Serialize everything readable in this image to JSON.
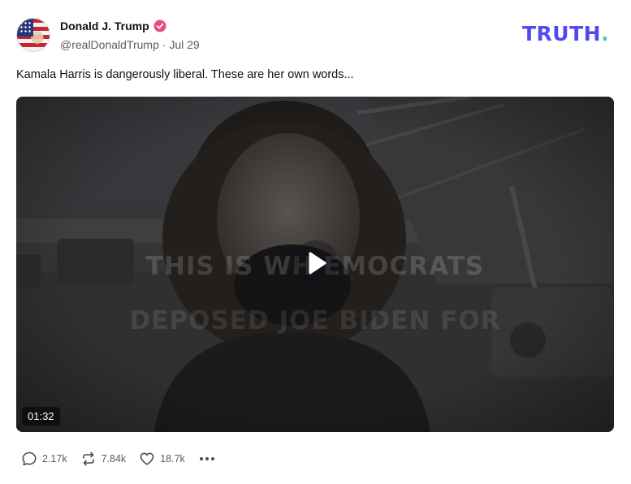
{
  "post": {
    "author_name": "Donald J. Trump",
    "handle": "@realDonaldTrump",
    "separator": " · ",
    "date": "Jul 29",
    "text": "Kamala Harris is dangerously liberal. These are her own words...",
    "verified_icon": "verified-badge-icon",
    "verified_color": "#ea4c7d"
  },
  "brand": {
    "logo_text": "TRUTH",
    "logo_dot": ".",
    "logo_color": "#5448ee",
    "dot_color": "#2fd7b4"
  },
  "video": {
    "caption_line_1": "THIS IS WH   EMOCRATS",
    "caption_line_2": "DEPOSED JOE BIDEN FOR",
    "duration": "01:32",
    "play_icon": "play-icon"
  },
  "actions": {
    "replies": {
      "icon": "reply-icon",
      "count": "2.17k"
    },
    "retruths": {
      "icon": "retruth-icon",
      "count": "7.84k"
    },
    "likes": {
      "icon": "heart-icon",
      "count": "18.7k"
    },
    "more": {
      "icon": "more-icon"
    }
  }
}
